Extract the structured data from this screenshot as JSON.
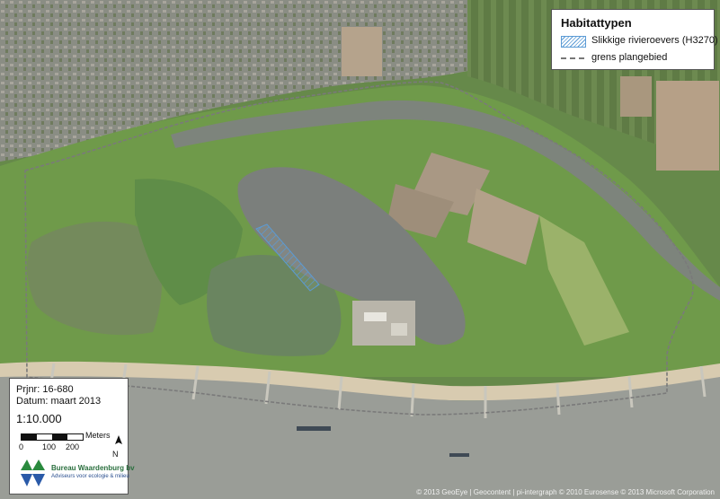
{
  "legend": {
    "title": "Habitattypen",
    "items": [
      {
        "label": "Slikkige rivieroevers (H3270)",
        "symbol": "blue-hatch-icon"
      },
      {
        "label": "grens plangebied",
        "symbol": "dashed-line-icon"
      }
    ]
  },
  "info": {
    "project": "Prjnr: 16-680",
    "date": "Datum: maart 2013",
    "scale": "1:10.000",
    "scalebar_ticks": [
      "0",
      "100",
      "200"
    ],
    "scalebar_unit": "Meters",
    "north": "N",
    "company_name": "Bureau Waardenburg bv",
    "company_tagline": "Adviseurs voor ecologie & milieu"
  },
  "copyright": "© 2013 GeoEye | Geocontent | pi-intergraph © 2010 Eurosense © 2013 Microsoft Corporation",
  "colors": {
    "habitat": "#5b9bd5",
    "boundary": "#777777",
    "river": "#9a9d97",
    "lake": "#7b7f7c",
    "grass": "#6f9a4a",
    "urban": "#8f9088",
    "beach": "#d8cbb0",
    "logo_green": "#2a8a3e",
    "logo_blue": "#2a5aa8"
  }
}
